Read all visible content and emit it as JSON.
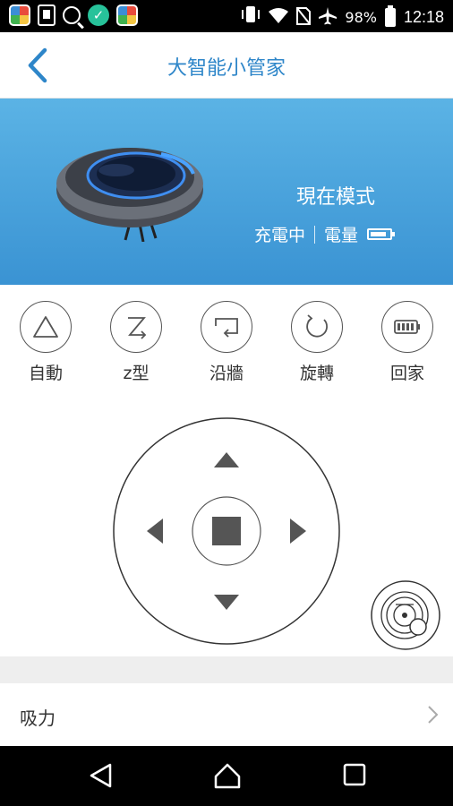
{
  "status_bar": {
    "battery": "98%",
    "time": "12:18",
    "left_icons": [
      "photos-icon",
      "clipboard-icon",
      "search-icon",
      "check-icon",
      "photos-icon"
    ],
    "right_icons": [
      "vibrate-icon",
      "wifi-icon",
      "no-sim-icon",
      "airplane-icon",
      "battery-icon"
    ]
  },
  "header": {
    "title": "大智能小管家"
  },
  "banner": {
    "mode_title": "現在模式",
    "charging": "充電中",
    "battery_label": "電量",
    "battery_level": 0.85,
    "color_top": "#5bb3e5",
    "color_bottom": "#3a93d3"
  },
  "modes": [
    {
      "label": "自動",
      "icon": "triangle-icon"
    },
    {
      "label": "z型",
      "icon": "zigzag-icon"
    },
    {
      "label": "沿牆",
      "icon": "wall-follow-icon"
    },
    {
      "label": "旋轉",
      "icon": "spin-icon"
    },
    {
      "label": "回家",
      "icon": "battery-home-icon"
    }
  ],
  "controller": {
    "up": "arrow-up-icon",
    "down": "arrow-down-icon",
    "left": "arrow-left-icon",
    "right": "arrow-right-icon",
    "center": "stop-icon"
  },
  "suction": {
    "label": "吸力"
  },
  "accent": "#2e86c9"
}
